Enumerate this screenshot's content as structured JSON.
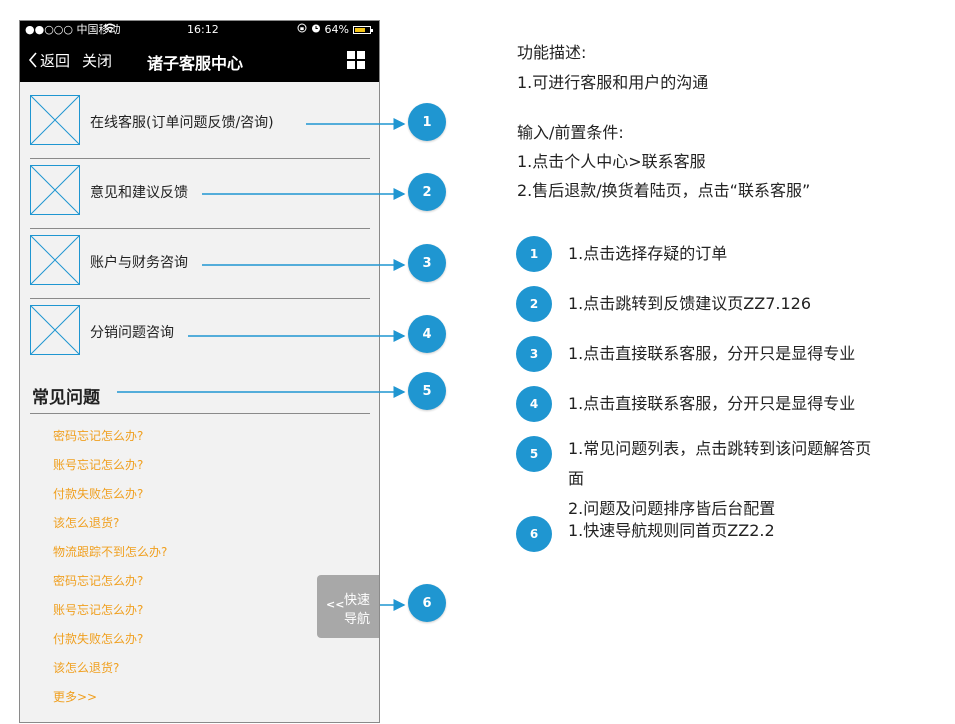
{
  "status_bar": {
    "carrier": "●●○○○ 中国移动",
    "time": "16:12",
    "battery_pct": "64%"
  },
  "nav": {
    "back_label": "返回",
    "close_label": "关闭",
    "title": "诸子客服中心"
  },
  "menu": [
    {
      "label": "在线客服(订单问题反馈/咨询)"
    },
    {
      "label": "意见和建议反馈"
    },
    {
      "label": "账户与财务咨询"
    },
    {
      "label": "分销问题咨询"
    }
  ],
  "faq": {
    "title": "常见问题",
    "items": [
      "密码忘记怎么办?",
      "账号忘记怎么办?",
      "付款失败怎么办?",
      "该怎么退货?",
      "物流跟踪不到怎么办?",
      "密码忘记怎么办?",
      "账号忘记怎么办?",
      "付款失败怎么办?",
      "该怎么退货?",
      "更多>>"
    ]
  },
  "quick_nav": {
    "arrow": "<<",
    "line1": "快速",
    "line2": "导航"
  },
  "badges": [
    "1",
    "2",
    "3",
    "4",
    "5",
    "6"
  ],
  "spec": {
    "desc_title": "功能描述:",
    "desc_1": "1.可进行客服和用户的沟通",
    "pre_title": "输入/前置条件:",
    "pre_1": "1.点击个人中心>联系客服",
    "pre_2": "2.售后退款/换货着陆页，点击“联系客服”",
    "notes": [
      "1.点击选择存疑的订单",
      "1.点击跳转到反馈建议页ZZ7.126",
      "1.点击直接联系客服，分开只是显得专业",
      "1.点击直接联系客服，分开只是显得专业",
      "1.常见问题列表，点击跳转到该问题解答页",
      "面",
      "2.问题及问题排序皆后台配置",
      "1.快速导航规则同首页ZZ2.2"
    ]
  },
  "colors": {
    "accent": "#1f96d1",
    "faq_link": "#f0a020",
    "bar": "#000000"
  }
}
